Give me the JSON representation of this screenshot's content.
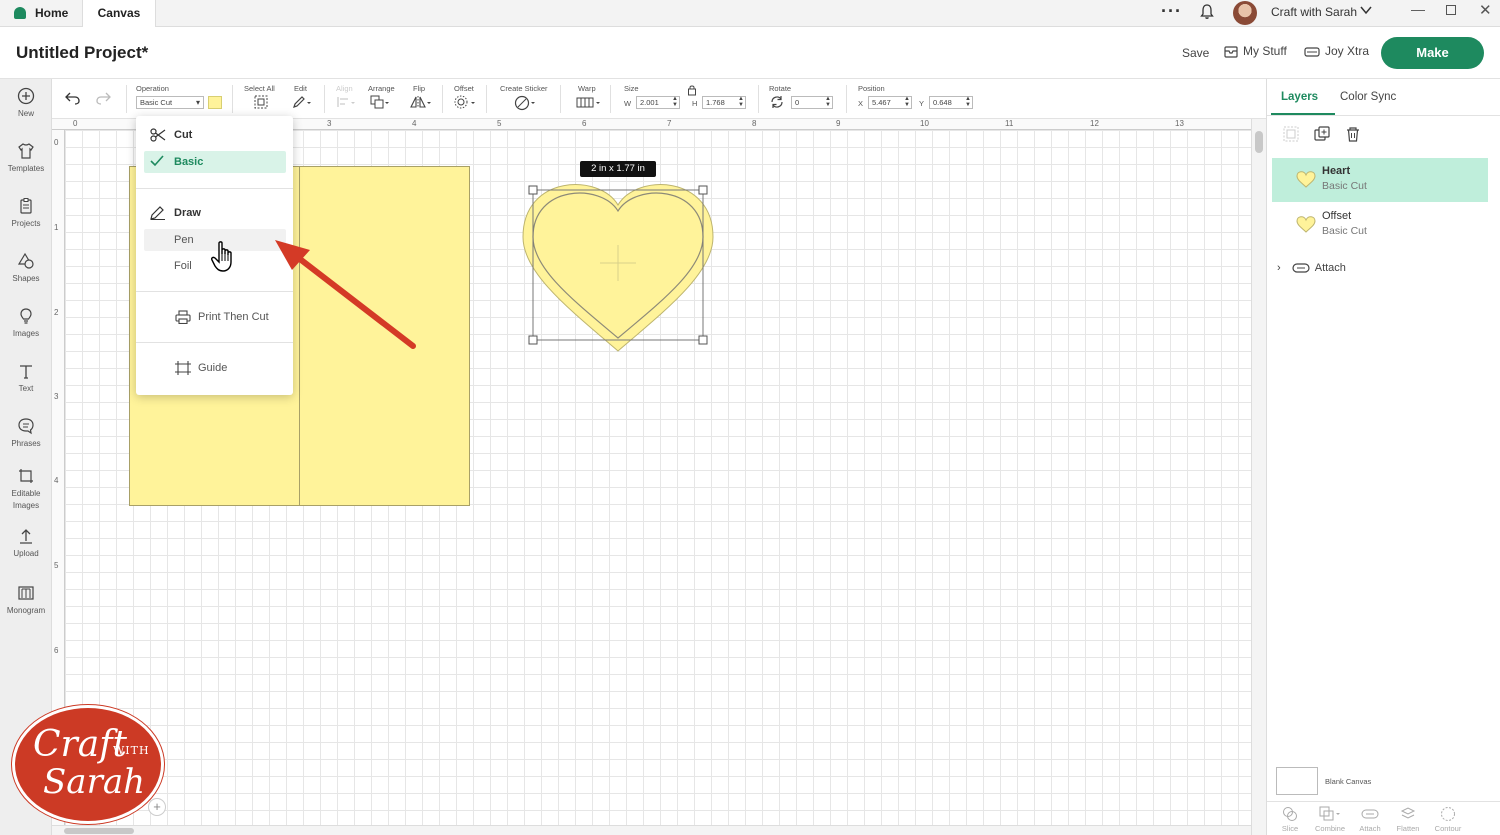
{
  "titlebar": {
    "tabs": [
      "Home",
      "Canvas"
    ],
    "user_name": "Craft with Sarah"
  },
  "header": {
    "project_title": "Untitled Project*",
    "save": "Save",
    "my_stuff": "My Stuff",
    "machine": "Joy Xtra",
    "make": "Make",
    "accent_color": "#1e8a5f"
  },
  "left_rail": [
    {
      "label": "New",
      "icon": "plus-circle-icon"
    },
    {
      "label": "Templates",
      "icon": "shirt-icon"
    },
    {
      "label": "Projects",
      "icon": "clipboard-icon"
    },
    {
      "label": "Shapes",
      "icon": "shapes-icon"
    },
    {
      "label": "Images",
      "icon": "lightbulb-icon"
    },
    {
      "label": "Text",
      "icon": "text-icon"
    },
    {
      "label": "Phrases",
      "icon": "speech-bubble-icon"
    },
    {
      "label": "Editable Images",
      "icon": "editable-image-icon"
    },
    {
      "label": "Upload",
      "icon": "upload-icon"
    },
    {
      "label": "Monogram",
      "icon": "monogram-icon"
    }
  ],
  "toolbar": {
    "operation_label": "Operation",
    "operation_value": "Basic Cut",
    "operation_color": "#fff39a",
    "select_all": "Select All",
    "edit": "Edit",
    "align": "Align",
    "arrange": "Arrange",
    "flip": "Flip",
    "offset": "Offset",
    "create_sticker": "Create Sticker",
    "warp": "Warp",
    "size": "Size",
    "w_label": "W",
    "w_value": "2.001",
    "h_label": "H",
    "h_value": "1.768",
    "rotate": "Rotate",
    "rotate_value": "0",
    "position": "Position",
    "x_label": "X",
    "x_value": "5.467",
    "y_label": "Y",
    "y_value": "0.648"
  },
  "ruler": {
    "top": [
      "0",
      "3",
      "4",
      "5",
      "6",
      "7",
      "8",
      "9",
      "10",
      "11",
      "12",
      "13"
    ],
    "left": [
      "0",
      "1",
      "2",
      "3",
      "4",
      "5",
      "6"
    ]
  },
  "canvas": {
    "size_tooltip": "2  in x 1.77  in",
    "shape_color": "#fff39a"
  },
  "operation_menu": {
    "cut_header": "Cut",
    "basic": "Basic",
    "draw_header": "Draw",
    "pen": "Pen",
    "foil": "Foil",
    "print_then_cut": "Print Then Cut",
    "guide": "Guide",
    "selected": "Basic"
  },
  "right_panel": {
    "tabs": [
      "Layers",
      "Color Sync"
    ],
    "layers": [
      {
        "name": "Heart",
        "operation": "Basic Cut",
        "selected": true
      },
      {
        "name": "Offset",
        "operation": "Basic Cut",
        "selected": false
      }
    ],
    "attach_group": "Attach",
    "blank_canvas": "Blank Canvas",
    "bottom_tools": [
      "Slice",
      "Combine",
      "Attach",
      "Flatten",
      "Contour"
    ]
  },
  "watermark": {
    "line1": "Craft",
    "line2": "WITH",
    "line3": "Sarah"
  }
}
